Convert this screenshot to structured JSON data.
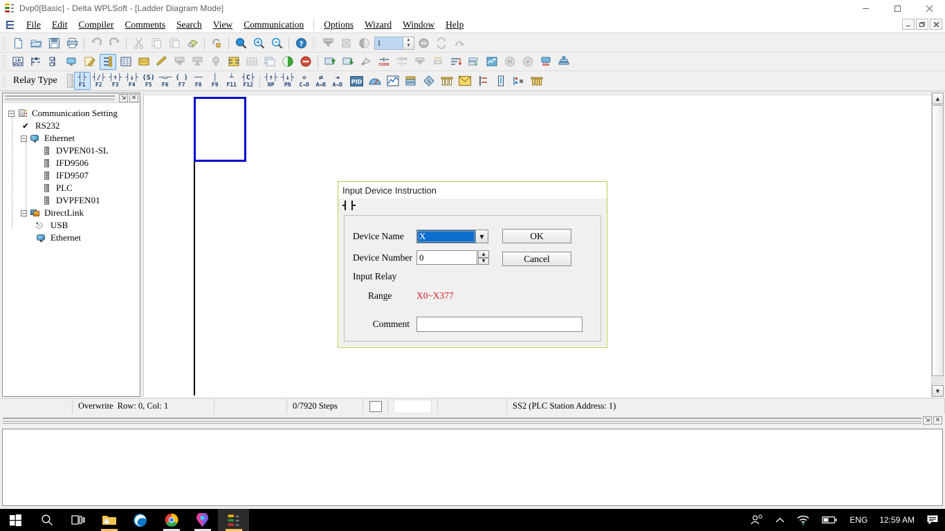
{
  "window": {
    "title": "Dvp0[Basic] - Delta WPLSoft - [Ladder Diagram Mode]",
    "app_icon": "ladder-app-icon",
    "minimize": "—",
    "maximize": "❐",
    "close": "✕",
    "mdi_minimize": "_",
    "mdi_restore": "❐",
    "mdi_close": "✕"
  },
  "menu": {
    "icon": "ladder-menu-icon",
    "items": [
      {
        "label": "File",
        "accel": "F"
      },
      {
        "label": "Edit",
        "accel": "E"
      },
      {
        "label": "Compiler",
        "accel": "C"
      },
      {
        "label": "Comments",
        "accel": "m"
      },
      {
        "label": "Search",
        "accel": "S"
      },
      {
        "label": "View",
        "accel": "V"
      },
      {
        "label": "Communication",
        "accel": "C"
      },
      {
        "label": "Options",
        "accel": "O"
      },
      {
        "label": "Wizard",
        "accel": "i"
      },
      {
        "label": "Window",
        "accel": "W"
      },
      {
        "label": "Help",
        "accel": "H"
      }
    ]
  },
  "toolbar_standard": {
    "buttons": [
      {
        "name": "new-file-icon"
      },
      {
        "name": "open-file-icon"
      },
      {
        "name": "save-file-icon"
      },
      {
        "name": "print-icon"
      },
      {
        "name": "undo-icon"
      },
      {
        "name": "redo-icon"
      },
      {
        "name": "cut-icon"
      },
      {
        "name": "copy-icon"
      },
      {
        "name": "paste-icon"
      },
      {
        "name": "eraser-icon"
      },
      {
        "name": "refresh-icon"
      },
      {
        "name": "zoom-icon"
      },
      {
        "name": "zoom-in-icon"
      },
      {
        "name": "zoom-out-icon"
      },
      {
        "name": "help-icon"
      },
      {
        "name": "download-to-plc-icon"
      },
      {
        "name": "delete-program-icon"
      },
      {
        "name": "run-stop-icon"
      },
      {
        "name": "reset-icon"
      },
      {
        "name": "sync-icon"
      },
      {
        "name": "jump-icon"
      }
    ],
    "step_value": "1"
  },
  "toolbar_ladder": {
    "buttons": [
      {
        "name": "ladder-instruction-list-icon"
      },
      {
        "name": "ladder-diagram-icon"
      },
      {
        "name": "sfc-icon"
      },
      {
        "name": "monitor-icon"
      },
      {
        "name": "edit-mode-icon"
      },
      {
        "name": "comm-setting-icon"
      },
      {
        "name": "device-table-icon"
      },
      {
        "name": "register-table-icon"
      },
      {
        "name": "pen-icon"
      },
      {
        "name": "plc-read-icon"
      },
      {
        "name": "plc-write-icon"
      },
      {
        "name": "bulb-icon"
      },
      {
        "name": "ladder-yellow-icon"
      },
      {
        "name": "grid-icon"
      },
      {
        "name": "copy-window-icon"
      },
      {
        "name": "run-icon"
      },
      {
        "name": "stop-icon"
      },
      {
        "name": "upload-icon"
      },
      {
        "name": "download-icon"
      },
      {
        "name": "satellite-icon"
      },
      {
        "name": "code-write-icon"
      },
      {
        "name": "code-read-icon"
      },
      {
        "name": "io-table-icon"
      },
      {
        "name": "program-compare-icon"
      },
      {
        "name": "sort-icon"
      },
      {
        "name": "window-tile-icon"
      },
      {
        "name": "chart-icon"
      },
      {
        "name": "modbus-icon"
      },
      {
        "name": "ip-icon"
      },
      {
        "name": "network-icon"
      },
      {
        "name": "settings-stack-icon"
      }
    ]
  },
  "toolbar_relay": {
    "label": "Relay Type",
    "dropdown_name": "relay-type-dropdown",
    "function_keys": [
      {
        "key": "F1",
        "sym": "┤├",
        "name": "normally-open-contact"
      },
      {
        "key": "F2",
        "sym": "┤/├",
        "name": "normally-closed-contact"
      },
      {
        "key": "F3",
        "sym": "┤↑├",
        "name": "rising-edge-contact"
      },
      {
        "key": "F4",
        "sym": "┤↓├",
        "name": "falling-edge-contact"
      },
      {
        "key": "F5",
        "sym": "(S)",
        "name": "set-coil"
      },
      {
        "key": "F6",
        "sym": "─▭─",
        "name": "application-instruction"
      },
      {
        "key": "F7",
        "sym": "( )",
        "name": "output-coil"
      },
      {
        "key": "F8",
        "sym": "──",
        "name": "horizontal-line"
      },
      {
        "key": "F9",
        "sym": "│",
        "name": "vertical-line"
      },
      {
        "key": "F11",
        "sym": "┴",
        "name": "delete-horizontal-line"
      },
      {
        "key": "F12",
        "sym": "┤C├",
        "name": "delete-vertical-line"
      },
      {
        "key": "NP",
        "sym": "┤↑├",
        "name": "rising-pulse"
      },
      {
        "key": "PN",
        "sym": "┤↓├",
        "name": "falling-pulse"
      },
      {
        "key": "C→D",
        "sym": "✲",
        "name": "contact-to-coil"
      },
      {
        "key": "A↔B",
        "sym": "⇄",
        "name": "swap-contacts"
      },
      {
        "key": "A→D",
        "sym": "⇥",
        "name": "insert-device"
      }
    ],
    "extra_buttons": [
      {
        "name": "pid-icon",
        "label": "PID"
      },
      {
        "name": "network-config-icon"
      },
      {
        "name": "trend-chart-icon"
      },
      {
        "name": "stack-layers-icon"
      },
      {
        "name": "money-icon"
      },
      {
        "name": "barchart-icon"
      },
      {
        "name": "mail-icon"
      },
      {
        "name": "align-icon"
      },
      {
        "name": "thermometer-icon"
      },
      {
        "name": "step-icon"
      },
      {
        "name": "barchart2-icon"
      }
    ]
  },
  "left_panel": {
    "pin_label": "⇲",
    "close_label": "✕",
    "tree": [
      {
        "label": "Communication Setting",
        "icon": "communication-setting-icon",
        "level": 0,
        "expander": "−"
      },
      {
        "label": "RS232",
        "icon": "check-icon",
        "level": 1,
        "expander": null
      },
      {
        "label": "Ethernet",
        "icon": "ethernet-icon",
        "level": 1,
        "expander": "−"
      },
      {
        "label": "DVPEN01-SL",
        "icon": "module-icon",
        "level": 2,
        "expander": null
      },
      {
        "label": "IFD9506",
        "icon": "module-icon",
        "level": 2,
        "expander": null
      },
      {
        "label": "IFD9507",
        "icon": "module-icon",
        "level": 2,
        "expander": null
      },
      {
        "label": "PLC",
        "icon": "module-icon",
        "level": 2,
        "expander": null
      },
      {
        "label": "DVPFEN01",
        "icon": "module-icon",
        "level": 2,
        "expander": null
      },
      {
        "label": "DirectLink",
        "icon": "directlink-icon",
        "level": 1,
        "expander": "−"
      },
      {
        "label": "USB",
        "icon": "usb-icon",
        "level": 2,
        "expander": null
      },
      {
        "label": "Ethernet",
        "icon": "ethernet-icon",
        "level": 2,
        "expander": null
      }
    ]
  },
  "editor": {
    "scroll_up": "▲",
    "scroll_down": "▼",
    "selection_name": "ladder-cursor-selection"
  },
  "statusbar": {
    "mode": "Overwrite",
    "position": "Row: 0, Col: 1",
    "steps": "0/7920 Steps",
    "plc": "SS2 (PLC Station Address: 1)"
  },
  "bottom_panel": {
    "pin_label": "⇲",
    "close_label": "✕"
  },
  "dialog": {
    "title": "Input Device Instruction",
    "symbol": "normally-open-contact-symbol",
    "device_name_label": "Device Name",
    "device_name_value": "X",
    "device_number_label": "Device Number",
    "device_number_value": "0",
    "relay_type_label": "Input Relay",
    "range_label": "Range",
    "range_value": "X0~X377",
    "comment_label": "Comment",
    "comment_value": "",
    "ok_label": "OK",
    "cancel_label": "Cancel",
    "spin_up": "▲",
    "spin_down": "▼",
    "combo_arrow": "▼",
    "border_color": "#a8d44a",
    "range_color": "#d42020",
    "selection_color": "#0f6fd1"
  },
  "taskbar": {
    "items": [
      {
        "name": "start-button",
        "icon": "windows-logo"
      },
      {
        "name": "search-button",
        "icon": "search-icon"
      },
      {
        "name": "task-view-button",
        "icon": "task-view-icon"
      },
      {
        "name": "file-explorer-button",
        "icon": "folder-icon"
      },
      {
        "name": "edge-button",
        "icon": "edge-icon"
      },
      {
        "name": "chrome-button",
        "icon": "chrome-icon"
      },
      {
        "name": "maps-button",
        "icon": "maps-pin-icon"
      },
      {
        "name": "wplsoft-button",
        "icon": "ladder-app-icon"
      }
    ],
    "tray": {
      "people": "people-icon",
      "chevron": "⌃",
      "wifi": "wifi-icon",
      "battery": "battery-icon",
      "language": "ENG",
      "time": "12:59 AM",
      "notifications": "notification-icon"
    }
  }
}
